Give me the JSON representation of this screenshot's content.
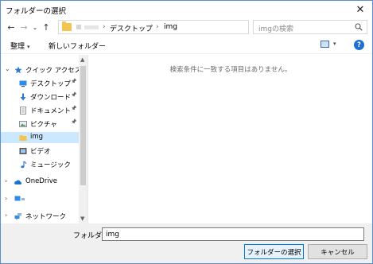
{
  "window": {
    "title": "フォルダーの選択",
    "close_glyph": "✕"
  },
  "nav": {
    "back_glyph": "←",
    "forward_glyph": "→",
    "recent_glyph": "⌄",
    "up_glyph": "↑"
  },
  "address": {
    "sep1": "›",
    "crumb1": "デスクトップ",
    "sep2": "›",
    "crumb2": "img",
    "dropdown_glyph": "⌄",
    "refresh_glyph": "↻"
  },
  "search": {
    "placeholder": "imgの検索"
  },
  "toolbar": {
    "organize_label": "整理",
    "caret": "▾",
    "new_folder_label": "新しいフォルダー",
    "view_caret": "▾",
    "help_label": "?"
  },
  "sidebar": {
    "items": [
      {
        "label": "クイック アクセス",
        "chevron": "⌄",
        "pinned": false,
        "icon": "star-icon"
      },
      {
        "label": "デスクトップ",
        "chevron": "",
        "pinned": true,
        "icon": "desktop-icon"
      },
      {
        "label": "ダウンロード",
        "chevron": "",
        "pinned": true,
        "icon": "download-icon"
      },
      {
        "label": "ドキュメント",
        "chevron": "",
        "pinned": true,
        "icon": "document-icon"
      },
      {
        "label": "ピクチャ",
        "chevron": "",
        "pinned": true,
        "icon": "pictures-icon"
      },
      {
        "label": "img",
        "chevron": "",
        "pinned": false,
        "icon": "folder-icon",
        "selected": true
      },
      {
        "label": "ビデオ",
        "chevron": "",
        "pinned": false,
        "icon": "video-icon"
      },
      {
        "label": "ミュージック",
        "chevron": "",
        "pinned": false,
        "icon": "music-icon"
      },
      {
        "label": "OneDrive",
        "chevron": "›",
        "pinned": false,
        "icon": "cloud-icon"
      },
      {
        "label": "",
        "chevron": "›",
        "pinned": false,
        "icon": "pc-icon"
      },
      {
        "label": "ネットワーク",
        "chevron": "›",
        "pinned": false,
        "icon": "network-icon"
      }
    ],
    "pin_glyph": "📌",
    "scroll_up_glyph": "▲",
    "scroll_down_glyph": "▼"
  },
  "content": {
    "empty_message": "検索条件に一致する項目はありません。"
  },
  "footer": {
    "folder_label": "フォルダー:",
    "folder_value": "img",
    "select_button": "フォルダーの選択",
    "cancel_button": "キャンセル"
  },
  "colors": {
    "accent": "#0078d7",
    "selected_bg": "#cce8ff",
    "folder_yellow": "#f3c44f"
  }
}
